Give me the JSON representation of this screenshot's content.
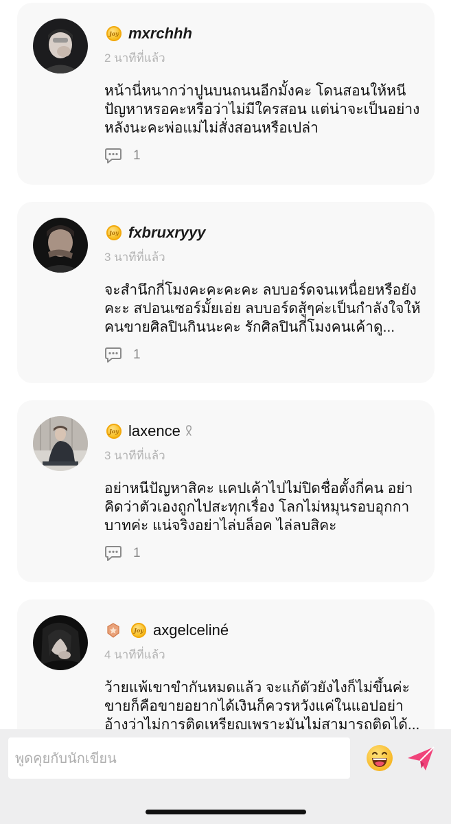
{
  "comments": [
    {
      "username": "mxrchhh",
      "time": "2 นาทีที่แล้ว",
      "text": "หน้านี่หนากว่าปูนบนถนนอีกมั้งคะ โดนสอนให้หนีปัญหาหรอคะหรือว่าไม่มีใครสอน แต่น่าจะเป็นอย่างหลังนะคะพ่อแม่ไม่สั่งสอนหรือเปล่า",
      "reply_count": "1",
      "coin_badge": "coin-icon"
    },
    {
      "username": "fxbruxryyy",
      "time": "3 นาทีที่แล้ว",
      "text": "จะสำนึกกี่โมงคะคะคะคะ ลบบอร์ดจนเหนื่อยหรือยังคะะ สปอนเซอร์มั้ยเอ่ย ลบบอร์ดสู้ๆค่ะเป็นกำลังใจให้คนขายศิลปินกินนะคะ รักศิลปินกี่โมงคนเค้าดู...",
      "reply_count": "1",
      "coin_badge": "coin-icon"
    },
    {
      "username": "laxence",
      "time": "3 นาทีที่แล้ว",
      "text": "อย่าหนีปัญหาสิคะ แคปเค้าไปไม่ปิดชื่อตั้งกี่คน อย่าคิดว่าตัวเองถูกไปสะทุกเรื่อง โลกไม่หมุนรอบอุกกาบาทค่ะ แน่จริงอย่าไล่บล็อค ไล่ลบสิคะ",
      "reply_count": "1",
      "coin_badge": "coin-icon",
      "extra_badge": "ribbon-icon"
    },
    {
      "username": "axgelceliné",
      "time": "4 นาทีที่แล้ว",
      "text": "ว้ายแพ้เขาขำกันหมดแล้ว จะแก้ตัวยังไงก็ไม่ขึ้นค่ะ ขายก็คือขายอยากได้เงินก็ควรหวังแค่ในแอปอย่าอ้างว่าไม่การติดเหรียญเพราะมันไม่สามารถติดได้...",
      "reply_count": "",
      "coin_badge": "coin-icon",
      "rank_badge": "rank-badge-icon"
    }
  ],
  "chat": {
    "placeholder": "พูดคุยกับนักเขียน",
    "emoji_icon": "laughing-emoji-icon",
    "send_icon": "paper-plane-send-icon"
  },
  "colors": {
    "card_bg": "#f8f8f8",
    "send_accent": "#f0437a",
    "coin": "#f7bd20",
    "timestamp": "#b4b4b4"
  }
}
